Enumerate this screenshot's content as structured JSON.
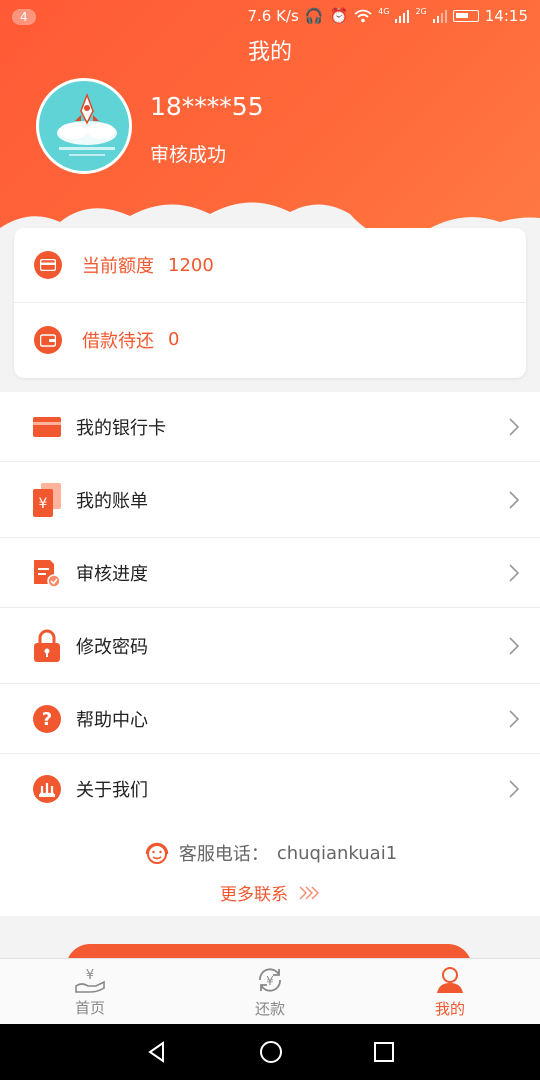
{
  "statusbar": {
    "notification_count": "4",
    "net_speed": "7.6 K/s",
    "time": "14:15",
    "signal_4g": "4G",
    "signal_2g": "2G"
  },
  "header": {
    "title": "我的"
  },
  "user": {
    "phone": "18****55",
    "status": "审核成功"
  },
  "quota": {
    "credit_label": "当前额度",
    "credit_value": "1200",
    "pending_label": "借款待还",
    "pending_value": "0"
  },
  "menu": {
    "items": [
      {
        "label": "我的银行卡",
        "icon": "bank-card-icon"
      },
      {
        "label": "我的账单",
        "icon": "bill-icon"
      },
      {
        "label": "审核进度",
        "icon": "review-progress-icon"
      },
      {
        "label": "修改密码",
        "icon": "lock-icon"
      },
      {
        "label": "帮助中心",
        "icon": "help-icon"
      },
      {
        "label": "关于我们",
        "icon": "about-icon"
      }
    ]
  },
  "contact": {
    "label": "客服电话：",
    "value": "chuqiankuai1",
    "more": "更多联系"
  },
  "tabbar": {
    "tabs": [
      {
        "label": "首页",
        "icon": "home-yuan-hand-icon",
        "active": false
      },
      {
        "label": "还款",
        "icon": "repay-icon",
        "active": false
      },
      {
        "label": "我的",
        "icon": "profile-icon",
        "active": true
      }
    ]
  },
  "colors": {
    "accent": "#f2582f",
    "header_gradient_start": "#ff5a36",
    "header_gradient_end": "#ff7a42"
  }
}
